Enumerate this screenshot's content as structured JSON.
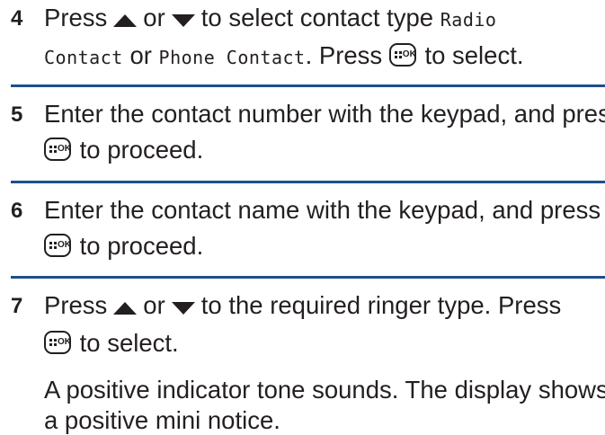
{
  "steps": [
    {
      "number": "4",
      "press": "Press",
      "or": "or",
      "to_select_type": "to select contact type",
      "radio_contact": "Radio",
      "radio_contact_2": "Contact",
      "or2": "or",
      "phone_contact": "Phone Contact",
      "press2": ". Press",
      "to_select": "to select."
    },
    {
      "number": "5",
      "line1": "Enter the contact number with the keypad, and press",
      "line2": "to proceed."
    },
    {
      "number": "6",
      "line1": "Enter the contact name with the keypad, and press",
      "line2": "to proceed."
    },
    {
      "number": "7",
      "press": "Press",
      "or": "or",
      "rest": "to the required ringer type. Press",
      "line2": "to select.",
      "result_line1": "A positive indicator tone sounds. The display shows",
      "result_line2": "a positive mini notice."
    }
  ],
  "icons": {
    "up": "up-arrow-icon",
    "down": "down-arrow-icon",
    "menu_ok": "menu-ok-key-icon",
    "menu_ok_label": "OK"
  },
  "colors": {
    "rule": "#1f4e8c",
    "text": "#231f20"
  }
}
